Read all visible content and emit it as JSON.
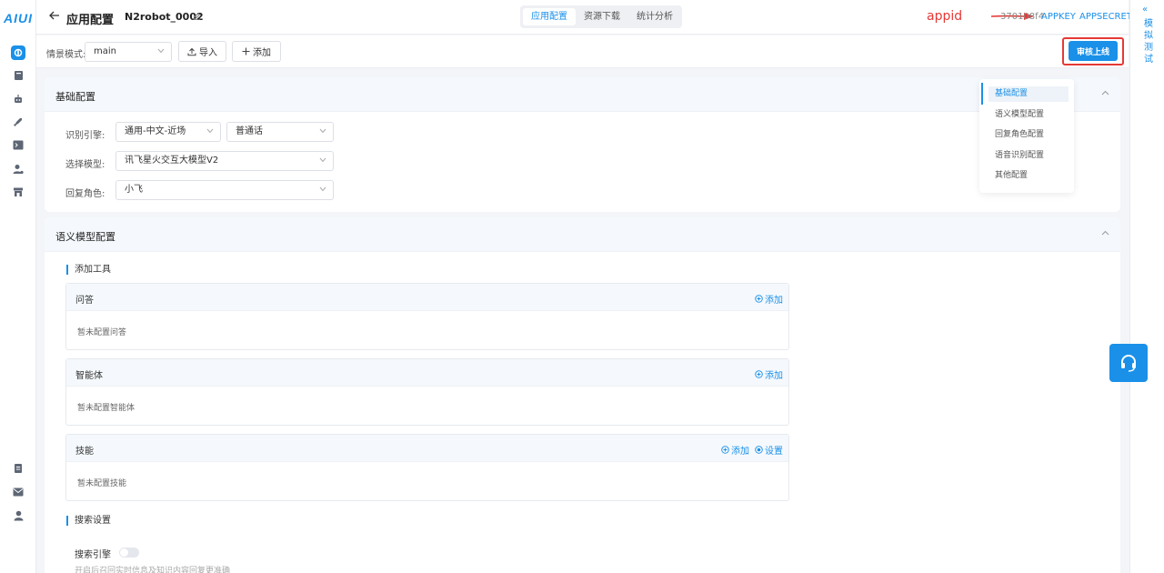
{
  "brand": {
    "logo_text": "AIUI"
  },
  "header": {
    "page_title": "应用配置",
    "app_name": "N2robot_0002",
    "tabs": [
      {
        "label": "应用配置",
        "active": true
      },
      {
        "label": "资源下载",
        "active": false
      },
      {
        "label": "统计分析",
        "active": false
      }
    ],
    "annotation": "appid",
    "appid_value": "370108f4",
    "appkey_label": "APPKEY",
    "appsecret_label": "APPSECRET"
  },
  "toolbar": {
    "scene_label": "情景模式:",
    "scene_value": "main",
    "import_label": "导入",
    "add_label": "添加",
    "review_label": "审核上线"
  },
  "side_panel": {
    "collapse_glyph": "«",
    "label": "模拟测试"
  },
  "basic_config": {
    "title": "基础配置",
    "engine_label": "识别引擎:",
    "engine_value": "通用-中文-近场",
    "dialect_value": "普通话",
    "model_label": "选择模型:",
    "model_value": "讯飞星火交互大模型V2",
    "role_label": "回复角色:",
    "role_value": "小飞"
  },
  "anchor_nav": {
    "items": [
      "基础配置",
      "语义模型配置",
      "回复角色配置",
      "语音识别配置",
      "其他配置"
    ],
    "active_index": 0
  },
  "semantic_config": {
    "title": "语义模型配置",
    "tools_title": "添加工具",
    "qa": {
      "name": "问答",
      "add_label": "添加",
      "empty_text": "暂未配置问答"
    },
    "agent": {
      "name": "智能体",
      "add_label": "添加",
      "empty_text": "暂未配置智能体"
    },
    "skills": {
      "name": "技能",
      "add_label": "添加",
      "settings_label": "设置",
      "empty_text": "暂未配置技能"
    },
    "search_title": "搜索设置",
    "search_engine_label": "搜索引擎",
    "search_engine_enabled": false,
    "search_hint": "开启后召回实时信息及知识内容回复更准确"
  },
  "colors": {
    "accent": "#1a90e8",
    "annotation_red": "#e53935",
    "review_button": "#1a90e8"
  },
  "icons": {
    "rail": [
      "app-icon",
      "book-icon",
      "robot-icon",
      "rocket-icon",
      "terminal-icon",
      "user-settings-icon",
      "store-icon",
      "document-icon",
      "mail-icon",
      "person-icon"
    ],
    "support": "headset-icon"
  }
}
